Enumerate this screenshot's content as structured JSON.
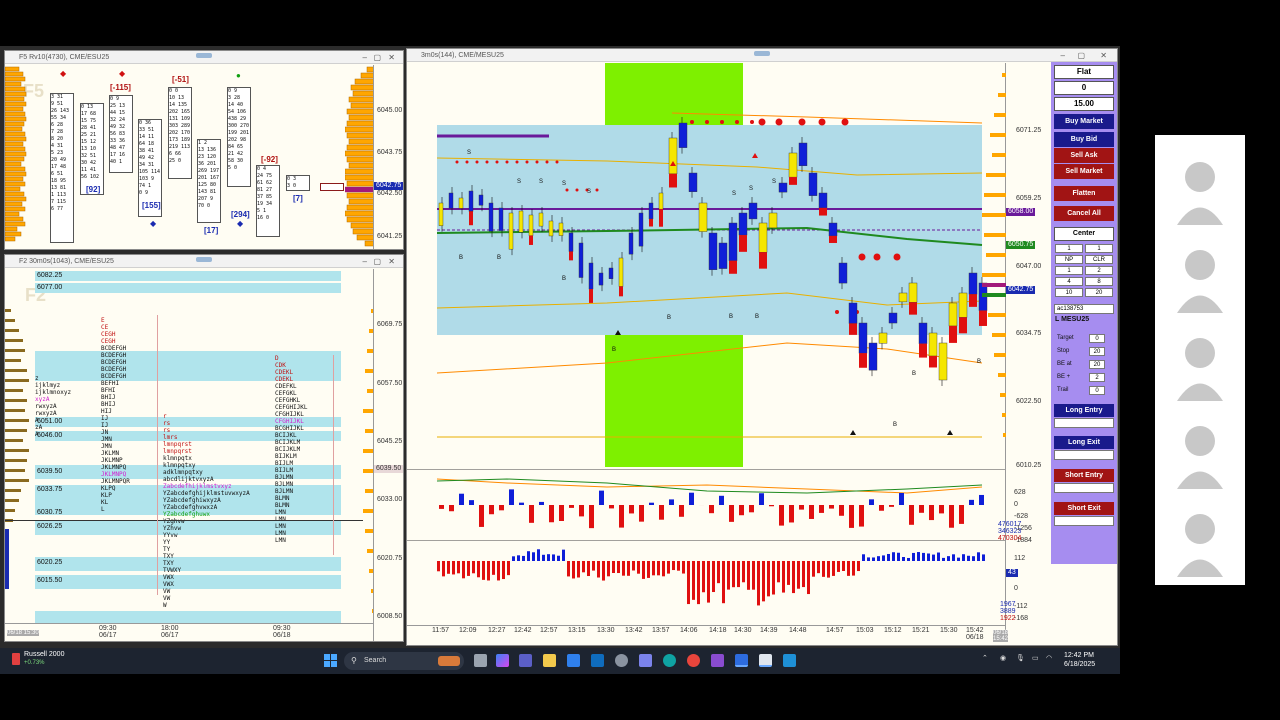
{
  "windows": {
    "fp": {
      "title": "F5 Rv10(4730), CME/ESU25",
      "watermark": "F5",
      "axis": [
        "6045.00",
        "6043.75",
        "6042.50",
        "6041.25"
      ],
      "last_price": "6042.75",
      "deltas": [
        "[-115]",
        "[-51]",
        "[92]",
        "[155]",
        "[17]",
        "[294]",
        "[-92]",
        "[7]"
      ]
    },
    "tpo": {
      "title": "F2 30m0s(1043), CME/ESU25",
      "watermark": "F2",
      "axis": [
        "6069.75",
        "6057.50",
        "6045.25",
        "6033.00",
        "6020.75",
        "6008.50"
      ],
      "levels": [
        "6082.25",
        "6077.00",
        "6051.00",
        "6046.00",
        "6039.50",
        "6033.75",
        "6030.75",
        "6026.25",
        "6020.25",
        "6015.50"
      ],
      "last_price": "6039.50",
      "time_labels": [
        "06/18 15:30",
        "09:30\n06/17",
        "18:00\n06/17",
        "09:30\n06/18"
      ]
    },
    "main": {
      "title": "3m0s(144), CME/MESU25",
      "axis": [
        "6071.25",
        "6059.25",
        "6047.00",
        "6034.75",
        "6022.50",
        "6010.25"
      ],
      "price_tags": [
        "6058.00",
        "6050.75",
        "6042.75"
      ],
      "osc1_axis": [
        "628",
        "0",
        "-628",
        "-1256",
        "-1884"
      ],
      "osc1_tags": [
        "476017",
        "346323",
        "470304"
      ],
      "osc2_axis": [
        "112",
        "0",
        "-112",
        "-168"
      ],
      "osc2_tags": [
        "1967",
        "3889",
        "1922"
      ],
      "osc2_tag_blue": "43",
      "time_labels": [
        "11:57",
        "12:09",
        "12:27",
        "12:42",
        "12:57",
        "13:15",
        "13:30",
        "13:42",
        "13:57",
        "14:06",
        "14:18",
        "14:30",
        "14:39",
        "14:48",
        "14:57",
        "15:03",
        "15:12",
        "15:21",
        "15:30",
        "15:42\n06/18"
      ],
      "corner_time": "06/18 15:42"
    }
  },
  "order_panel": {
    "position": "Flat",
    "qty": "0",
    "price": "15.00",
    "buttons": {
      "buy_market": "Buy Market",
      "buy_bid": "Buy Bid",
      "sell_ask": "Sell Ask",
      "sell_market": "Sell Market",
      "flatten": "Flatten",
      "cancel_all": "Cancel All",
      "center": "Center"
    },
    "qty_grid": [
      "1",
      "1",
      "NP",
      "CLR",
      "1",
      "2",
      "4",
      "8",
      "10",
      "20"
    ],
    "account": "ac138753",
    "instrument": "L MESU25",
    "params": [
      {
        "label": "Target",
        "value": "0"
      },
      {
        "label": "Stop",
        "value": "20"
      },
      {
        "label": "BE at",
        "value": "20"
      },
      {
        "label": "BE +",
        "value": "2"
      },
      {
        "label": "Trail",
        "value": "0"
      }
    ],
    "entries": [
      "Long Entry",
      "Long Exit",
      "Short Entry",
      "Short Exit"
    ]
  },
  "taskbar": {
    "ticker_name": "Russell 2000",
    "ticker_change": "+0.73%",
    "search_placeholder": "Search",
    "time": "12:42 PM",
    "date": "6/18/2025"
  },
  "colors": {
    "up": "#f5e600",
    "down": "#0f1fd8",
    "value_area": "#b0dbe8",
    "green_zone": "#7ef000",
    "panel": "#a68df0",
    "sell": "#a11414",
    "buy": "#1a1a8c"
  }
}
